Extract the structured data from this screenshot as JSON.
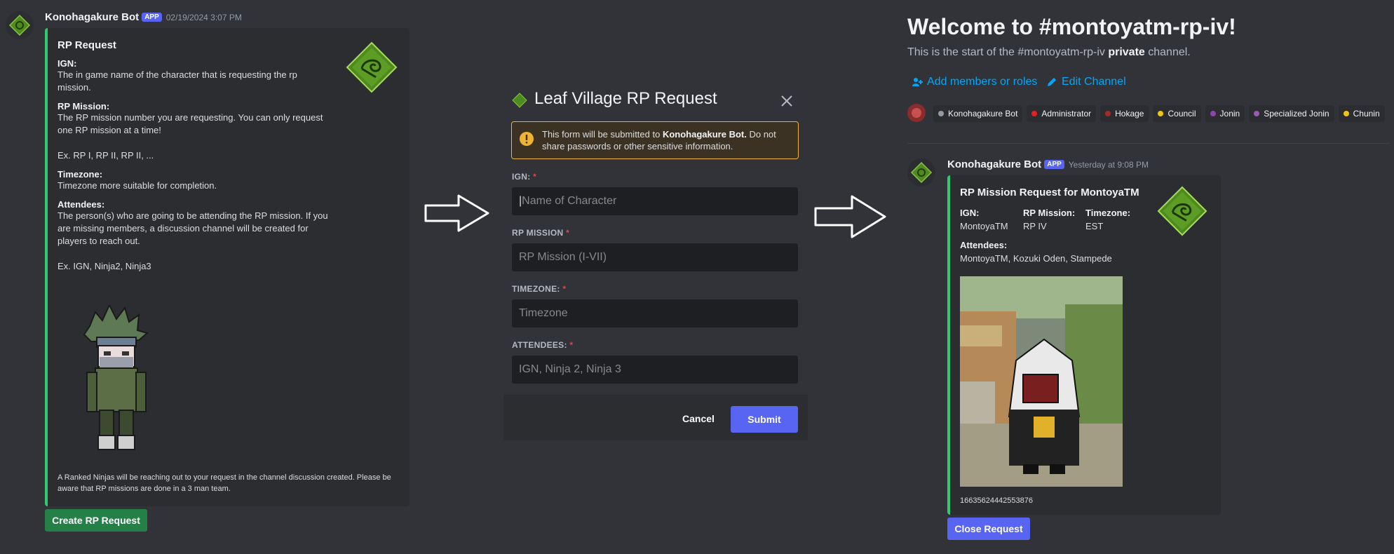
{
  "left_message": {
    "author": "Konohagakure Bot",
    "badge": "APP",
    "timestamp": "02/19/2024 3:07 PM",
    "embed": {
      "title": "RP Request",
      "fields": [
        {
          "name": "IGN:",
          "value": "The in game name of the character that is requesting the rp mission."
        },
        {
          "name": "RP Mission:",
          "value": "The RP mission number you are requesting. You can only request one RP mission at a time!\n\nEx. RP I, RP II, RP II, ..."
        },
        {
          "name": "Timezone:",
          "value": "Timezone more suitable for completion."
        },
        {
          "name": "Attendees:",
          "value": "The person(s) who are going to be attending the RP mission. If you are missing members, a discussion channel will be created for players to reach out.\n\nEx. IGN, Ninja2, Ninja3"
        }
      ],
      "footer": "A Ranked Ninjas will be reaching out to your request in the channel discussion created. Please be aware that RP missions are done in a 3 man team."
    },
    "button_label": "Create RP Request"
  },
  "modal": {
    "title": "Leaf Village RP Request",
    "warning_prefix": "This form will be submitted to ",
    "warning_bot": "Konohagakure Bot.",
    "warning_suffix": " Do not share passwords or other sensitive information.",
    "fields": [
      {
        "label": "IGN:",
        "required": "*",
        "placeholder": "Name of Character"
      },
      {
        "label": "RP MISSION",
        "required": "*",
        "placeholder": "RP Mission (I-VII)"
      },
      {
        "label": "TIMEZONE:",
        "required": "*",
        "placeholder": "Timezone"
      },
      {
        "label": "ATTENDEES:",
        "required": "*",
        "placeholder": "IGN, Ninja 2, Ninja 3"
      }
    ],
    "cancel_label": "Cancel",
    "submit_label": "Submit"
  },
  "channel": {
    "welcome": "Welcome to #montoyatm-rp-iv!",
    "subtitle_prefix": "This is the start of the #montoyatm-rp-iv ",
    "subtitle_bold": "private",
    "subtitle_suffix": " channel.",
    "add_members": "Add members or roles",
    "edit_channel": "Edit Channel",
    "roles": [
      {
        "name": "Konohagakure Bot",
        "color": "#949ba4"
      },
      {
        "name": "Administrator",
        "color": "#e91e1e"
      },
      {
        "name": "Hokage",
        "color": "#a52a2a"
      },
      {
        "name": "Council",
        "color": "#f1c40f"
      },
      {
        "name": "Jonin",
        "color": "#8e44ad"
      },
      {
        "name": "Specialized Jonin",
        "color": "#9b59b6"
      },
      {
        "name": "Chunin",
        "color": "#f1c40f"
      }
    ],
    "message": {
      "author": "Konohagakure Bot",
      "badge": "APP",
      "timestamp": "Yesterday at 9:08 PM",
      "embed": {
        "title": "RP Mission Request for MontoyaTM",
        "ign_label": "IGN:",
        "ign_value": "MontoyaTM",
        "mission_label": "RP Mission:",
        "mission_value": "RP IV",
        "tz_label": "Timezone:",
        "tz_value": "EST",
        "attendees_label": "Attendees:",
        "attendees_value": "MontoyaTM, Kozuki Oden, Stampede",
        "footer_id": "1663562444255387​6"
      },
      "button_label": "Close Request"
    }
  },
  "colors": {
    "accent": "#5865f2",
    "embed_border": "#2ecc71",
    "link": "#00a8fc",
    "leaf_green": "#4f8a1f"
  }
}
